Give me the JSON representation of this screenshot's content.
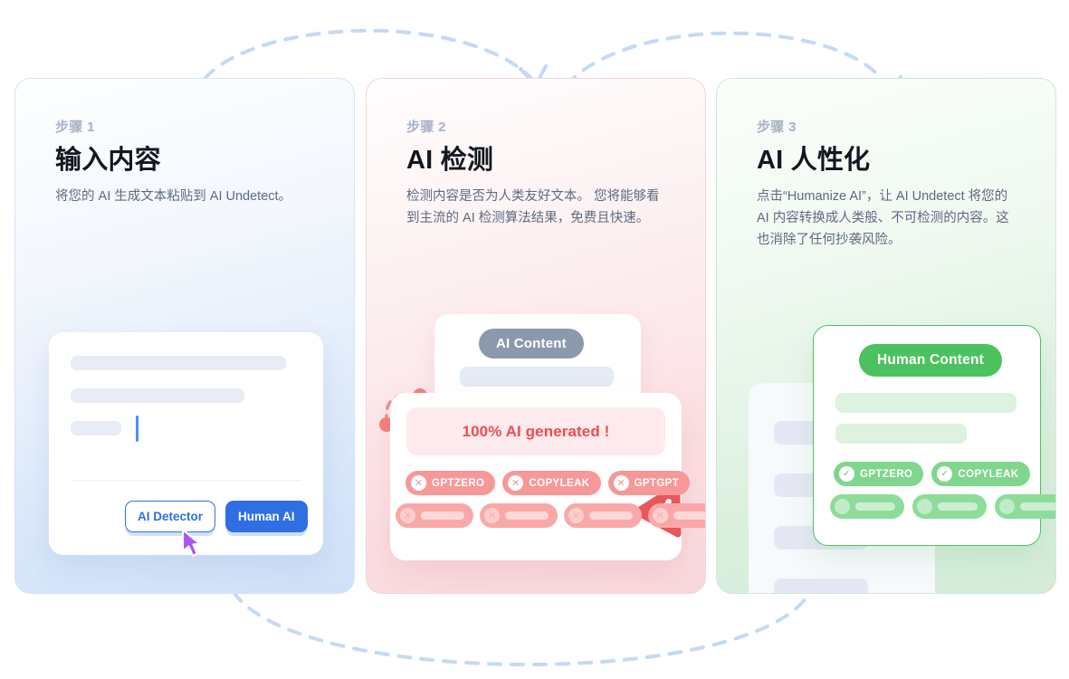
{
  "connectors": {
    "arc_color": "#c5d9f5",
    "arc1_name": "step1-to-step2-arrow",
    "arc2_name": "step2-to-step3-arrow",
    "arc3_name": "step3-to-step1-loop"
  },
  "cards": [
    {
      "step": "步骤 1",
      "title": "输入内容",
      "desc": "将您的 AI 生成文本粘贴到 AI Undetect。",
      "accent": "#2f6fe4",
      "illustration": {
        "buttons": [
          {
            "label": "AI Detector",
            "style": "outline"
          },
          {
            "label": "Human AI",
            "style": "solid"
          }
        ],
        "cursor": "mouse-cursor"
      }
    },
    {
      "step": "步骤 2",
      "title": "AI 检测",
      "desc": "检测内容是否为人类友好文本。 您将能够看到主流的 AI 检测算法结果，免费且快速。",
      "accent": "#ee4c52",
      "illustration": {
        "content_badge": "AI Content",
        "alert_text": "100% AI generated !",
        "detectors": [
          "GPTZERO",
          "COPYLEAK",
          "GPTGPT"
        ],
        "ghost_count": 4,
        "warning_icon": "warning-triangle-icon",
        "mark_glyph": "✕"
      }
    },
    {
      "step": "步骤 3",
      "title": "AI 人性化",
      "desc": "点击“Humanize AI”，让 AI Undetect 将您的 AI 内容转换成人类般、不可检测的内容。这也消除了任何抄袭风险。",
      "accent": "#4cc25f",
      "illustration": {
        "content_badge": "Human Content",
        "detectors": [
          "GPTZERO",
          "COPYLEAK"
        ],
        "ghost_count": 3,
        "success_icon": "check-badge-icon",
        "mark_glyph": "✓"
      }
    }
  ]
}
